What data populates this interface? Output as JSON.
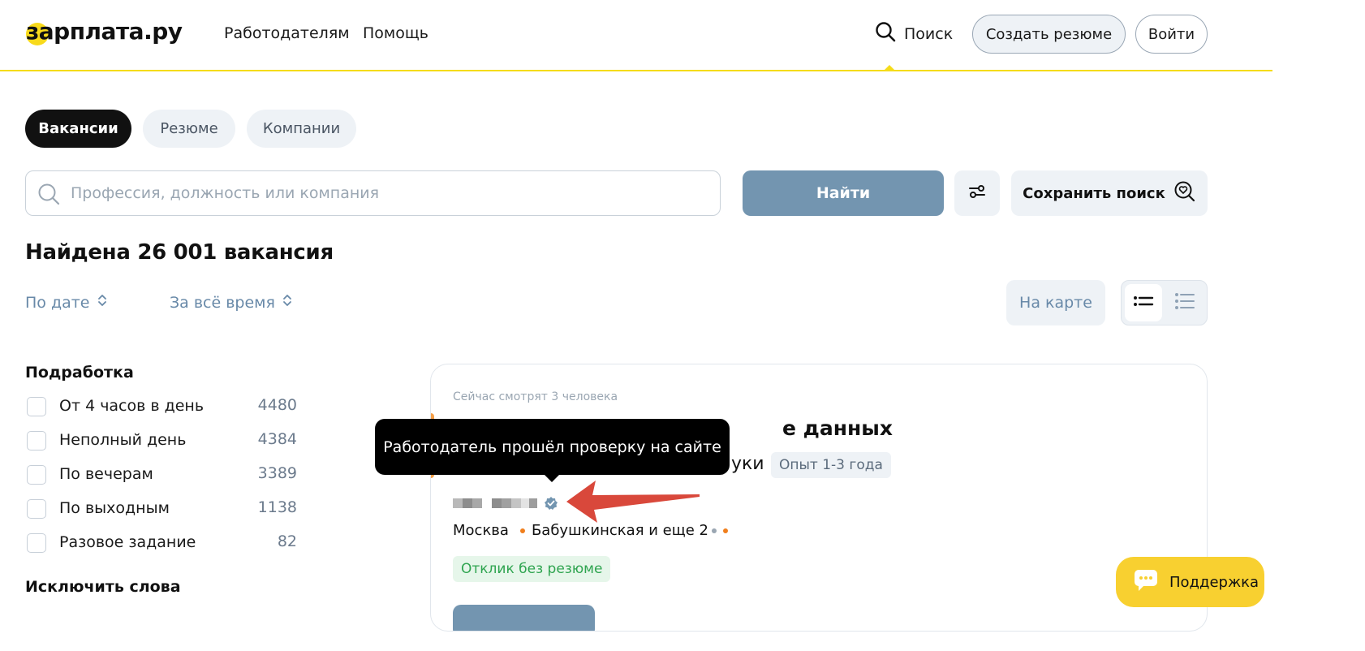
{
  "header": {
    "logo": "зарплата.ру",
    "nav": [
      "Работодателям",
      "Помощь"
    ],
    "search_label": "Поиск",
    "create_resume": "Создать резюме",
    "login": "Войти"
  },
  "tabs": [
    {
      "label": "Вакансии",
      "active": true
    },
    {
      "label": "Резюме",
      "active": false
    },
    {
      "label": "Компании",
      "active": false
    }
  ],
  "search": {
    "placeholder": "Профессия, должность или компания",
    "value": "",
    "find_button": "Найти",
    "save_button": "Сохранить поиск"
  },
  "results": {
    "title": "Найдена 26 001 вакансия",
    "sort_by": "По дате",
    "period": "За всё время",
    "map_button": "На карте",
    "view_mode": "list-compact"
  },
  "sidebar": {
    "section_title": "Подработка",
    "filters": [
      {
        "label": "От 4 часов в день",
        "count": "4480",
        "checked": false
      },
      {
        "label": "Неполный день",
        "count": "4384",
        "checked": false
      },
      {
        "label": "По вечерам",
        "count": "3389",
        "checked": false
      },
      {
        "label": "По выходным",
        "count": "1138",
        "checked": false
      },
      {
        "label": "Разовое задание",
        "count": "82",
        "checked": false
      }
    ],
    "exclude_title": "Исключить слова"
  },
  "vacancy": {
    "viewers": "Сейчас смотрят 3 человека",
    "title_visible": "е данных",
    "salary_visible": "уки",
    "experience": "Опыт 1-3 года",
    "city": "Москва",
    "metro": "Бабушкинская и еще 2",
    "no_resume_badge": "Отклик без резюме"
  },
  "tooltip": {
    "text": "Работодатель прошёл проверку на сайте"
  },
  "support": {
    "label": "Поддержка"
  },
  "colors": {
    "brand_yellow": "#f8da1b",
    "primary_button": "#7395b0",
    "link_blue": "#6889a8",
    "annotation_red": "#d9483b",
    "metro_orange": "#f07f1d"
  }
}
